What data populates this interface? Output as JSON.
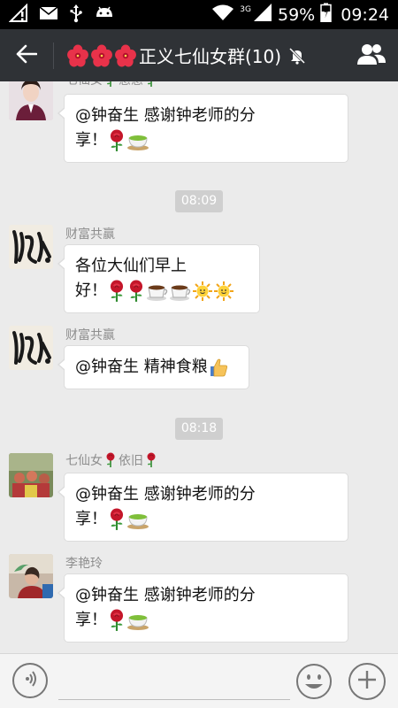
{
  "status": {
    "network": "3G",
    "battery": "59%",
    "time": "09:24",
    "icons": [
      "signal-warning-icon",
      "mail-icon",
      "usb-icon",
      "android-icon",
      "wifi-icon",
      "cell-signal-icon",
      "battery-icon"
    ]
  },
  "header": {
    "title": "正义七仙女群(10)",
    "title_emoji": [
      "hibiscus-icon",
      "hibiscus-icon",
      "hibiscus-icon"
    ],
    "back_icon": "back-arrow-icon",
    "mute_icon": "mute-bell-icon",
    "members_icon": "group-members-icon"
  },
  "messages": [
    {
      "type": "message",
      "sender_prefix": "七仙女",
      "sender_suffix": "惠惠",
      "line1": "@钟奋生 感谢钟老师的分",
      "line2": "享！",
      "emojis": [
        "rose-icon",
        "tea-icon"
      ]
    },
    {
      "type": "timestamp",
      "text": "08:09"
    },
    {
      "type": "message",
      "sender": "财富共赢",
      "line1": "各位大仙们早上",
      "line2": "好！",
      "emojis": [
        "rose-icon",
        "rose-icon",
        "coffee-icon",
        "coffee-icon",
        "sun-icon",
        "sun-icon"
      ]
    },
    {
      "type": "message",
      "sender": "财富共赢",
      "line1": "@钟奋生 精神食粮",
      "emojis": [
        "thumbs-up-icon"
      ]
    },
    {
      "type": "timestamp",
      "text": "08:18"
    },
    {
      "type": "message",
      "sender_prefix": "七仙女",
      "sender_suffix": "依旧",
      "line1": "@钟奋生 感谢钟老师的分",
      "line2": "享！",
      "emojis": [
        "rose-icon",
        "tea-icon"
      ]
    },
    {
      "type": "message",
      "sender": "李艳玲",
      "line1": "@钟奋生 感谢钟老师的分",
      "line2": "享！",
      "emojis": [
        "rose-icon",
        "tea-icon"
      ]
    }
  ],
  "input_bar": {
    "voice_icon": "voice-icon",
    "placeholder": "",
    "emoji_icon": "emoji-icon",
    "plus_icon": "plus-icon"
  }
}
